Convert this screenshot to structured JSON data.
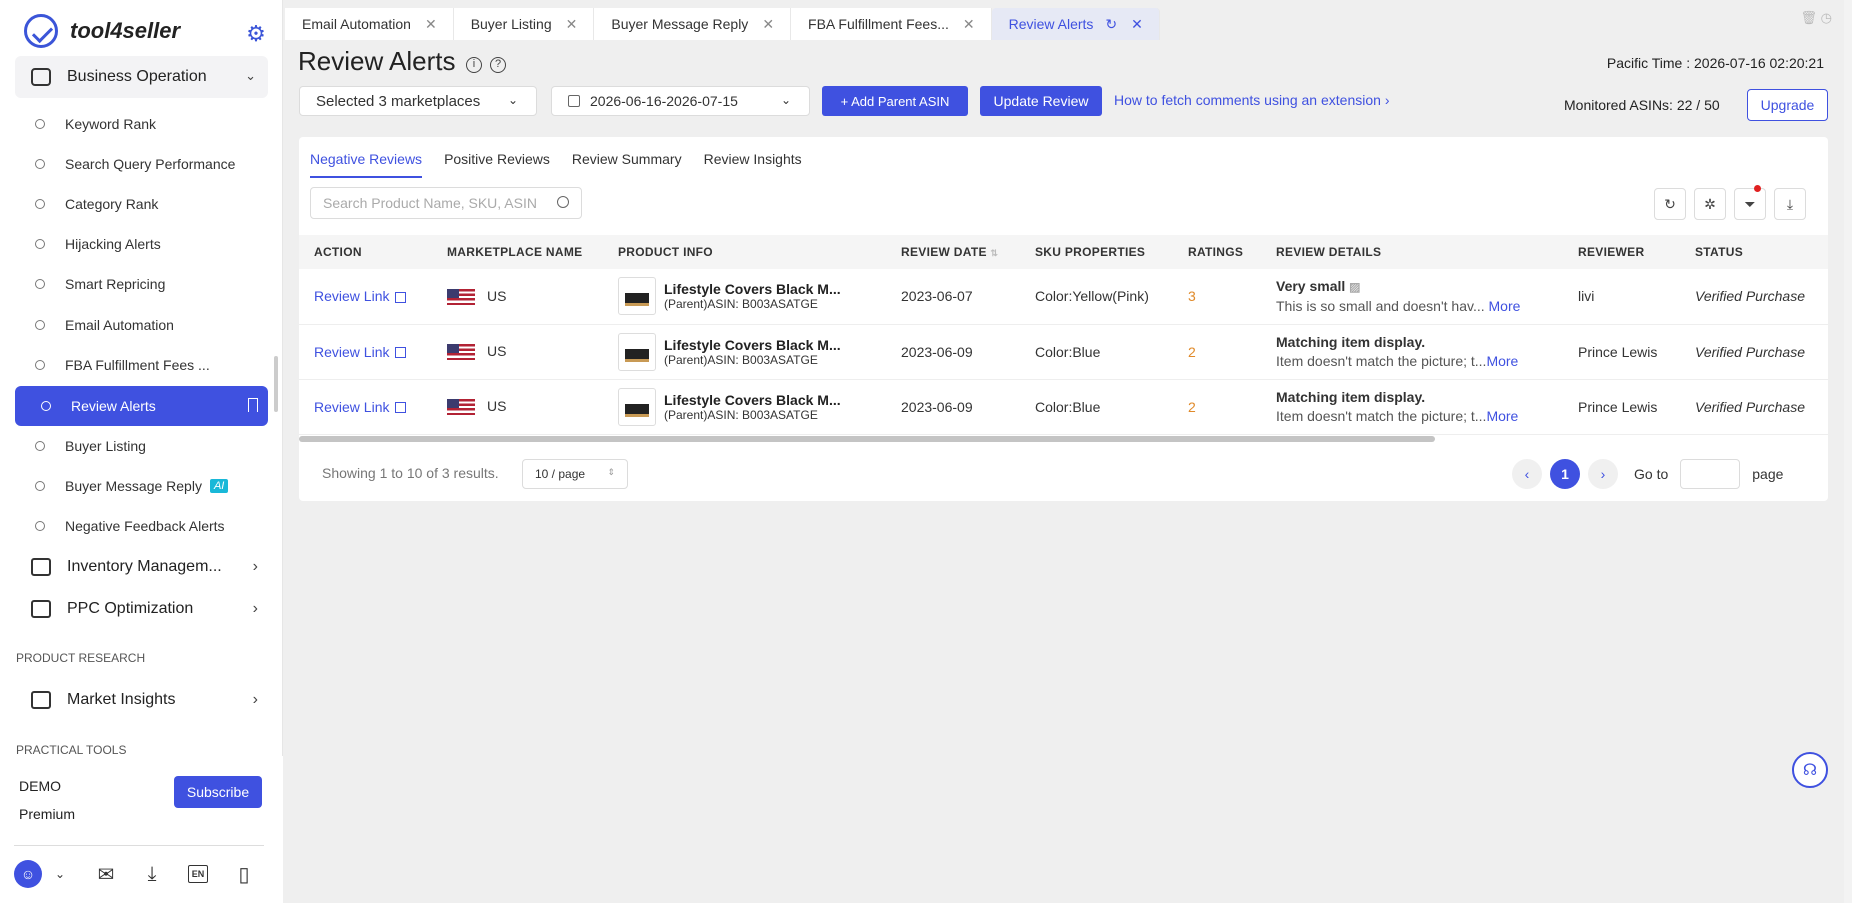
{
  "app": {
    "name": "tool4seller"
  },
  "sidebar": {
    "group": "Business Operation",
    "items": [
      {
        "label": "Keyword Rank"
      },
      {
        "label": "Search Query Performance"
      },
      {
        "label": "Category Rank"
      },
      {
        "label": "Hijacking Alerts"
      },
      {
        "label": "Smart Repricing"
      },
      {
        "label": "Email Automation"
      },
      {
        "label": "FBA Fulfillment Fees ..."
      },
      {
        "label": "Review Alerts"
      },
      {
        "label": "Buyer Listing"
      },
      {
        "label": "Buyer Message Reply",
        "badge": "AI"
      },
      {
        "label": "Negative Feedback Alerts"
      }
    ],
    "groups": [
      "Inventory Managem...",
      "PPC Optimization"
    ],
    "section_product_research": "PRODUCT RESEARCH",
    "market_insights": "Market Insights",
    "section_practical_tools": "PRACTICAL TOOLS",
    "footer": {
      "demo": "DEMO",
      "plan": "Premium",
      "subscribe": "Subscribe",
      "lang": "EN"
    }
  },
  "tabs": [
    "Email Automation",
    "Buyer Listing",
    "Buyer Message Reply",
    "FBA Fulfillment Fees...",
    "Review Alerts"
  ],
  "header": {
    "title": "Review Alerts",
    "pacific_time": "Pacific Time : 2026-07-16 02:20:21",
    "marketplaces": "Selected 3 marketplaces",
    "date_range": "2026-06-16-2026-07-15",
    "add_parent_asin": "+ Add Parent ASIN",
    "update_review": "Update Review",
    "howto": "How to fetch comments using an extension",
    "monitored": "Monitored ASINs: 22 / 50",
    "upgrade": "Upgrade"
  },
  "subtabs": [
    "Negative Reviews",
    "Positive Reviews",
    "Review Summary",
    "Review Insights"
  ],
  "search": {
    "placeholder": "Search Product Name, SKU, ASIN"
  },
  "table": {
    "columns": [
      "ACTION",
      "MARKETPLACE NAME",
      "PRODUCT INFO",
      "REVIEW DATE",
      "SKU PROPERTIES",
      "RATINGS",
      "REVIEW DETAILS",
      "REVIEWER",
      "STATUS"
    ],
    "rows": [
      {
        "action": "Review Link",
        "market": "US",
        "title": "Lifestyle Covers Black M...",
        "asin": "(Parent)ASIN: B003ASATGE",
        "date": "2023-06-07",
        "sku": "Color:Yellow(Pink)",
        "rating": "3",
        "rv_title": "Very small",
        "rv_body": "This is so small and doesn't hav...",
        "more": "More",
        "reviewer": "livi",
        "status": "Verified Purchase"
      },
      {
        "action": "Review Link",
        "market": "US",
        "title": "Lifestyle Covers Black M...",
        "asin": "(Parent)ASIN: B003ASATGE",
        "date": "2023-06-09",
        "sku": "Color:Blue",
        "rating": "2",
        "rv_title": "Matching item display.",
        "rv_body": "Item doesn't match the picture; t...",
        "more": "More",
        "reviewer": "Prince Lewis",
        "status": "Verified Purchase"
      },
      {
        "action": "Review Link",
        "market": "US",
        "title": "Lifestyle Covers Black M...",
        "asin": "(Parent)ASIN: B003ASATGE",
        "date": "2023-06-09",
        "sku": "Color:Blue",
        "rating": "2",
        "rv_title": "Matching item display.",
        "rv_body": "Item doesn't match the picture; t...",
        "more": "More",
        "reviewer": "Prince Lewis",
        "status": "Verified Purchase"
      }
    ]
  },
  "pagination": {
    "showing": "Showing 1 to 10 of 3 results.",
    "page_size": "10 / page",
    "current": "1",
    "goto": "Go to",
    "page": "page"
  }
}
